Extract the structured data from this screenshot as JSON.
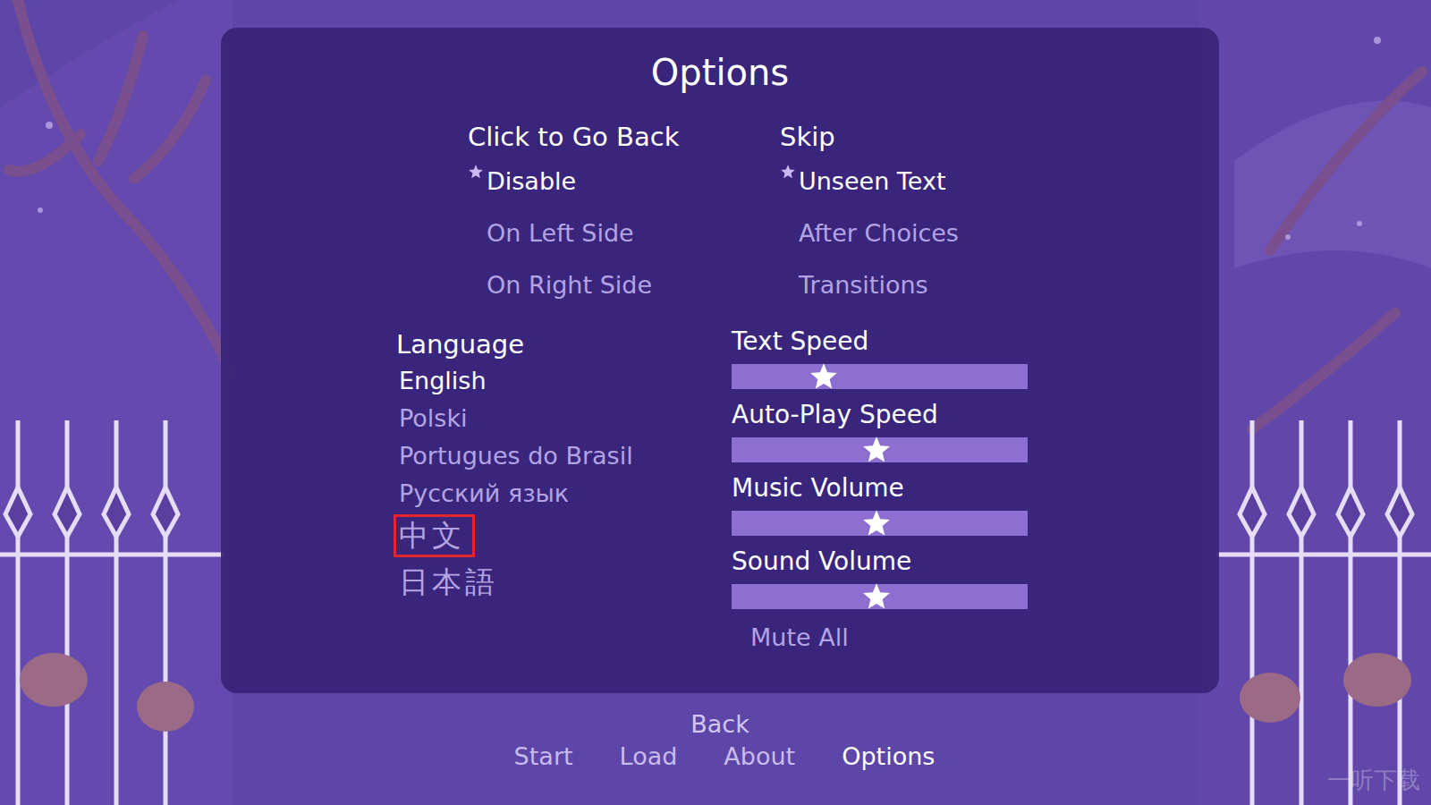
{
  "title": "Options",
  "option_groups": [
    {
      "label": "Click to Go Back",
      "items": [
        {
          "label": "Disable",
          "selected": true
        },
        {
          "label": "On Left Side",
          "selected": false
        },
        {
          "label": "On Right Side",
          "selected": false
        }
      ]
    },
    {
      "label": "Skip",
      "items": [
        {
          "label": "Unseen Text",
          "selected": true
        },
        {
          "label": "After Choices",
          "selected": false
        },
        {
          "label": "Transitions",
          "selected": false
        }
      ]
    }
  ],
  "language": {
    "label": "Language",
    "items": [
      {
        "label": "English",
        "selected": true,
        "highlighted": false,
        "cjk": false
      },
      {
        "label": "Polski",
        "selected": false,
        "highlighted": false,
        "cjk": false
      },
      {
        "label": "Portugues do Brasil",
        "selected": false,
        "highlighted": false,
        "cjk": false
      },
      {
        "label": "Русский язык",
        "selected": false,
        "highlighted": false,
        "cjk": false
      },
      {
        "label": "中文",
        "selected": false,
        "highlighted": true,
        "cjk": true
      },
      {
        "label": "日本語",
        "selected": false,
        "highlighted": false,
        "cjk": true
      }
    ]
  },
  "sliders": [
    {
      "label": "Text Speed",
      "level": 0.31
    },
    {
      "label": "Auto-Play Speed",
      "level": 0.49
    },
    {
      "label": "Music Volume",
      "level": 0.49
    },
    {
      "label": "Sound Volume",
      "level": 0.49
    }
  ],
  "mute": {
    "label": "Mute All",
    "on": false
  },
  "back": "Back",
  "nav": [
    {
      "label": "Start",
      "selected": false
    },
    {
      "label": "Load",
      "selected": false
    },
    {
      "label": "About",
      "selected": false
    },
    {
      "label": "Options",
      "selected": true
    }
  ],
  "watermark": "一听下载"
}
